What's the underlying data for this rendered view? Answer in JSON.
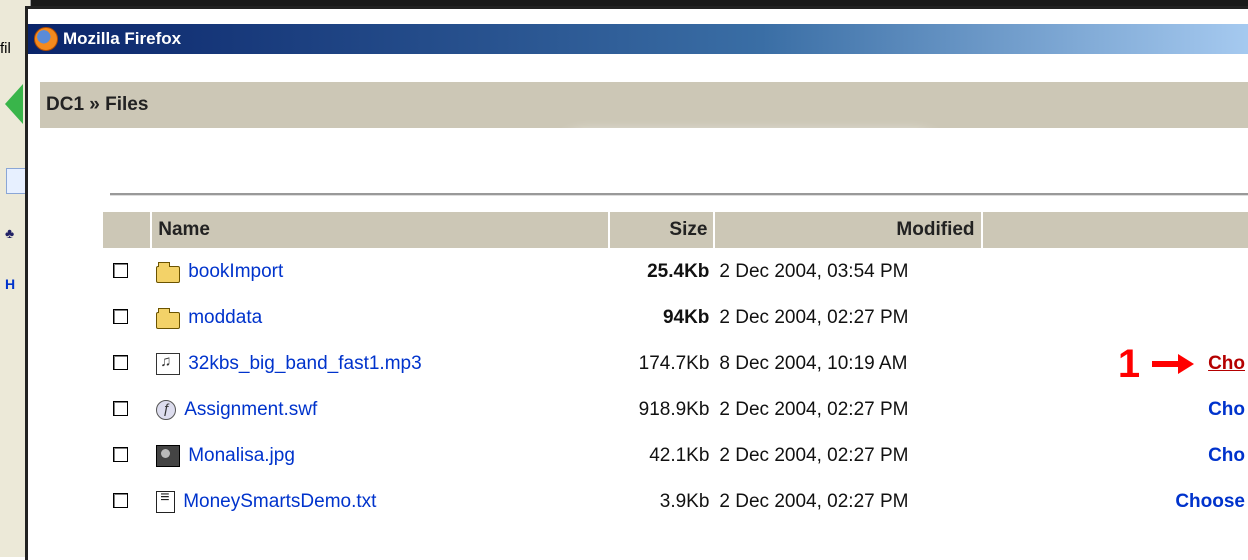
{
  "background_window": {
    "fragment_text": "fil",
    "side_letter": "H"
  },
  "window": {
    "title": "Mozilla Firefox"
  },
  "page": {
    "breadcrumb": "DC1 » Files"
  },
  "table": {
    "headers": {
      "name": "Name",
      "size": "Size",
      "modified": "Modified"
    },
    "rows": [
      {
        "name": "bookImport",
        "icon": "folder-icon",
        "size": "25.4Kb",
        "size_bold": true,
        "modified": "2 Dec 2004, 03:54 PM",
        "action": ""
      },
      {
        "name": "moddata",
        "icon": "folder-icon",
        "size": "94Kb",
        "size_bold": true,
        "modified": "2 Dec 2004, 02:27 PM",
        "action": ""
      },
      {
        "name": "32kbs_big_band_fast1.mp3",
        "icon": "audio-file-icon",
        "size": "174.7Kb",
        "size_bold": false,
        "modified": "8 Dec 2004, 10:19 AM",
        "action": "Cho",
        "action_highlight": true
      },
      {
        "name": "Assignment.swf",
        "icon": "flash-file-icon",
        "size": "918.9Kb",
        "size_bold": false,
        "modified": "2 Dec 2004, 02:27 PM",
        "action": "Cho"
      },
      {
        "name": "Monalisa.jpg",
        "icon": "image-file-icon",
        "size": "42.1Kb",
        "size_bold": false,
        "modified": "2 Dec 2004, 02:27 PM",
        "action": "Cho"
      },
      {
        "name": "MoneySmartsDemo.txt",
        "icon": "text-file-icon",
        "size": "3.9Kb",
        "size_bold": false,
        "modified": "2 Dec 2004, 02:27 PM",
        "action": "Choose"
      }
    ]
  },
  "annotation": {
    "number": "1",
    "color": "#ff0000"
  },
  "colors": {
    "header_bg": "#ccc7b6",
    "link": "#0033cc",
    "highlight_link": "#b40000",
    "titlebar_start": "#0a246a",
    "titlebar_end": "#a6caf0"
  }
}
